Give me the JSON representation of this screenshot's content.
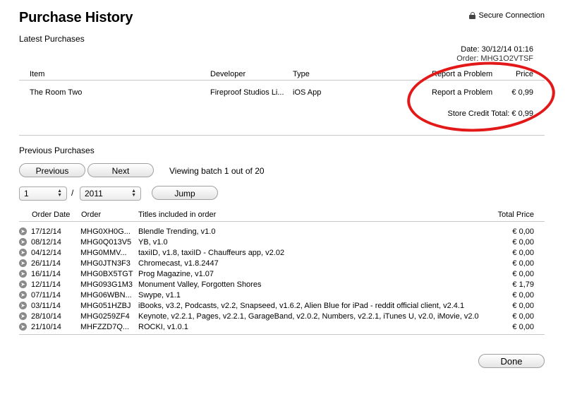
{
  "header": {
    "title": "Purchase History",
    "secure_label": "Secure Connection"
  },
  "latest": {
    "section_title": "Latest Purchases",
    "date_line": "Date: 30/12/14 01:16",
    "order_line": "Order: MHG1Q2VTSF",
    "columns": {
      "item": "Item",
      "developer": "Developer",
      "type": "Type",
      "report": "Report a Problem",
      "price": "Price"
    },
    "row": {
      "item": "The Room Two",
      "developer": "Fireproof Studios Li...",
      "type": "iOS App",
      "report": "Report a Problem",
      "price": "€ 0,99"
    },
    "total": "Store Credit Total: € 0,99"
  },
  "previous": {
    "section_title": "Previous Purchases",
    "prev_label": "Previous",
    "next_label": "Next",
    "batch_text": "Viewing batch 1 out of 20",
    "batch_select": "1",
    "slash": "/",
    "year_select": "2011",
    "jump_label": "Jump",
    "columns": {
      "date": "Order Date",
      "order": "Order",
      "titles": "Titles included in order",
      "total": "Total Price"
    },
    "rows": [
      {
        "date": "17/12/14",
        "order": "MHG0XH0G...",
        "titles": "Blendle Trending, v1.0",
        "total": "€ 0,00"
      },
      {
        "date": "08/12/14",
        "order": "MHG0Q013V5",
        "titles": "YB, v1.0",
        "total": "€ 0,00"
      },
      {
        "date": "04/12/14",
        "order": "MHG0MMV...",
        "titles": "taxiID, v1.8, taxiID - Chauffeurs app, v2.02",
        "total": "€ 0,00"
      },
      {
        "date": "26/11/14",
        "order": "MHG0JTN3F3",
        "titles": "Chromecast, v1.8.2447",
        "total": "€ 0,00"
      },
      {
        "date": "16/11/14",
        "order": "MHG0BX5TGT",
        "titles": "Prog Magazine, v1.07",
        "total": "€ 0,00"
      },
      {
        "date": "12/11/14",
        "order": "MHG093G1M3",
        "titles": "Monument Valley, Forgotten Shores",
        "total": "€ 1,79"
      },
      {
        "date": "07/11/14",
        "order": "MHG06WBN...",
        "titles": "Swype, v1.1",
        "total": "€ 0,00"
      },
      {
        "date": "03/11/14",
        "order": "MHG051HZBJ",
        "titles": "iBooks, v3.2, Podcasts, v2.2, Snapseed, v1.6.2, Alien Blue for iPad - reddit official client, v2.4.1",
        "total": "€ 0,00"
      },
      {
        "date": "28/10/14",
        "order": "MHG0259ZF4",
        "titles": "Keynote, v2.2.1, Pages, v2.2.1, GarageBand, v2.0.2, Numbers, v2.2.1, iTunes U, v2.0, iMovie, v2.0",
        "total": "€ 0,00"
      },
      {
        "date": "21/10/14",
        "order": "MHFZZD7Q...",
        "titles": "ROCKI, v1.0.1",
        "total": "€ 0,00"
      }
    ]
  },
  "footer": {
    "done_label": "Done"
  },
  "colors": {
    "annotation_red": "#e31818",
    "divider": "#c8c8c8"
  }
}
